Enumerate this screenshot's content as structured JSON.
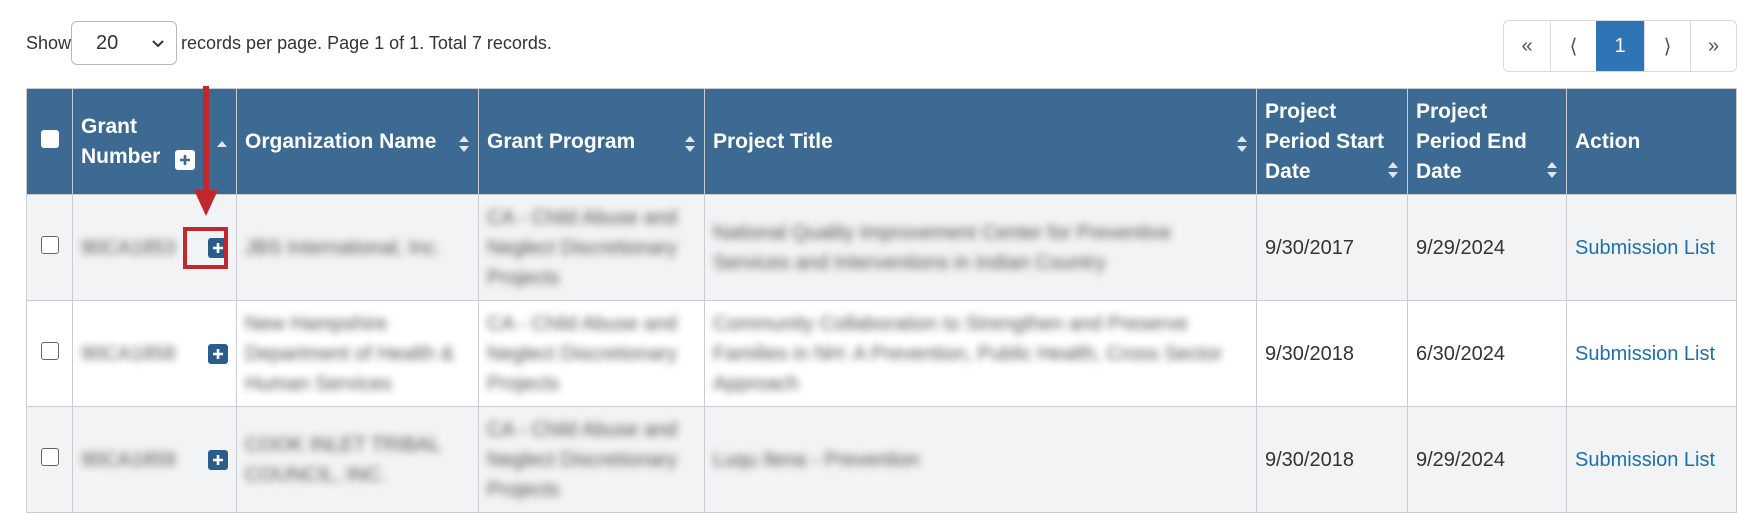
{
  "pager_info": {
    "show_label": "Show",
    "per_page_value": "20",
    "summary": "records per page. Page 1 of 1. Total 7 records."
  },
  "pagination": {
    "first": "«",
    "prev": "⟨",
    "current": "1",
    "next": "⟩",
    "last": "»"
  },
  "table": {
    "headers": {
      "grant_number": "Grant Number",
      "organization_name": "Organization Name",
      "grant_program": "Grant Program",
      "project_title": "Project Title",
      "start_date": "Project Period Start Date",
      "end_date": "Project Period End Date",
      "action": "Action"
    },
    "rows": [
      {
        "grant_number": "90CA1853",
        "organization_name": "JBS International, Inc.",
        "grant_program": "CA - Child Abuse and Neglect Discretionary Projects",
        "project_title": "National Quality Improvement Center for Preventive Services and Interventions in Indian Country",
        "start_date": "9/30/2017",
        "end_date": "9/29/2024",
        "action": "Submission List"
      },
      {
        "grant_number": "90CA1858",
        "organization_name": "New Hampshire Department of Health & Human Services",
        "grant_program": "CA - Child Abuse and Neglect Discretionary Projects",
        "project_title": "Community Collaboration to Strengthen and Preserve Families in NH: A Prevention, Public Health, Cross Sector Approach",
        "start_date": "9/30/2018",
        "end_date": "6/30/2024",
        "action": "Submission List"
      },
      {
        "grant_number": "90CA1859",
        "organization_name": "COOK INLET TRIBAL COUNCIL, INC.",
        "grant_program": "CA - Child Abuse and Neglect Discretionary Projects",
        "project_title": "Luqu Ilena - Prevention",
        "start_date": "9/30/2018",
        "end_date": "9/29/2024",
        "action": "Submission List"
      }
    ]
  },
  "colors": {
    "header_bg": "#3c6a93",
    "active_page": "#2f74b5",
    "link": "#1a6fb4",
    "highlight": "#c0282d"
  }
}
